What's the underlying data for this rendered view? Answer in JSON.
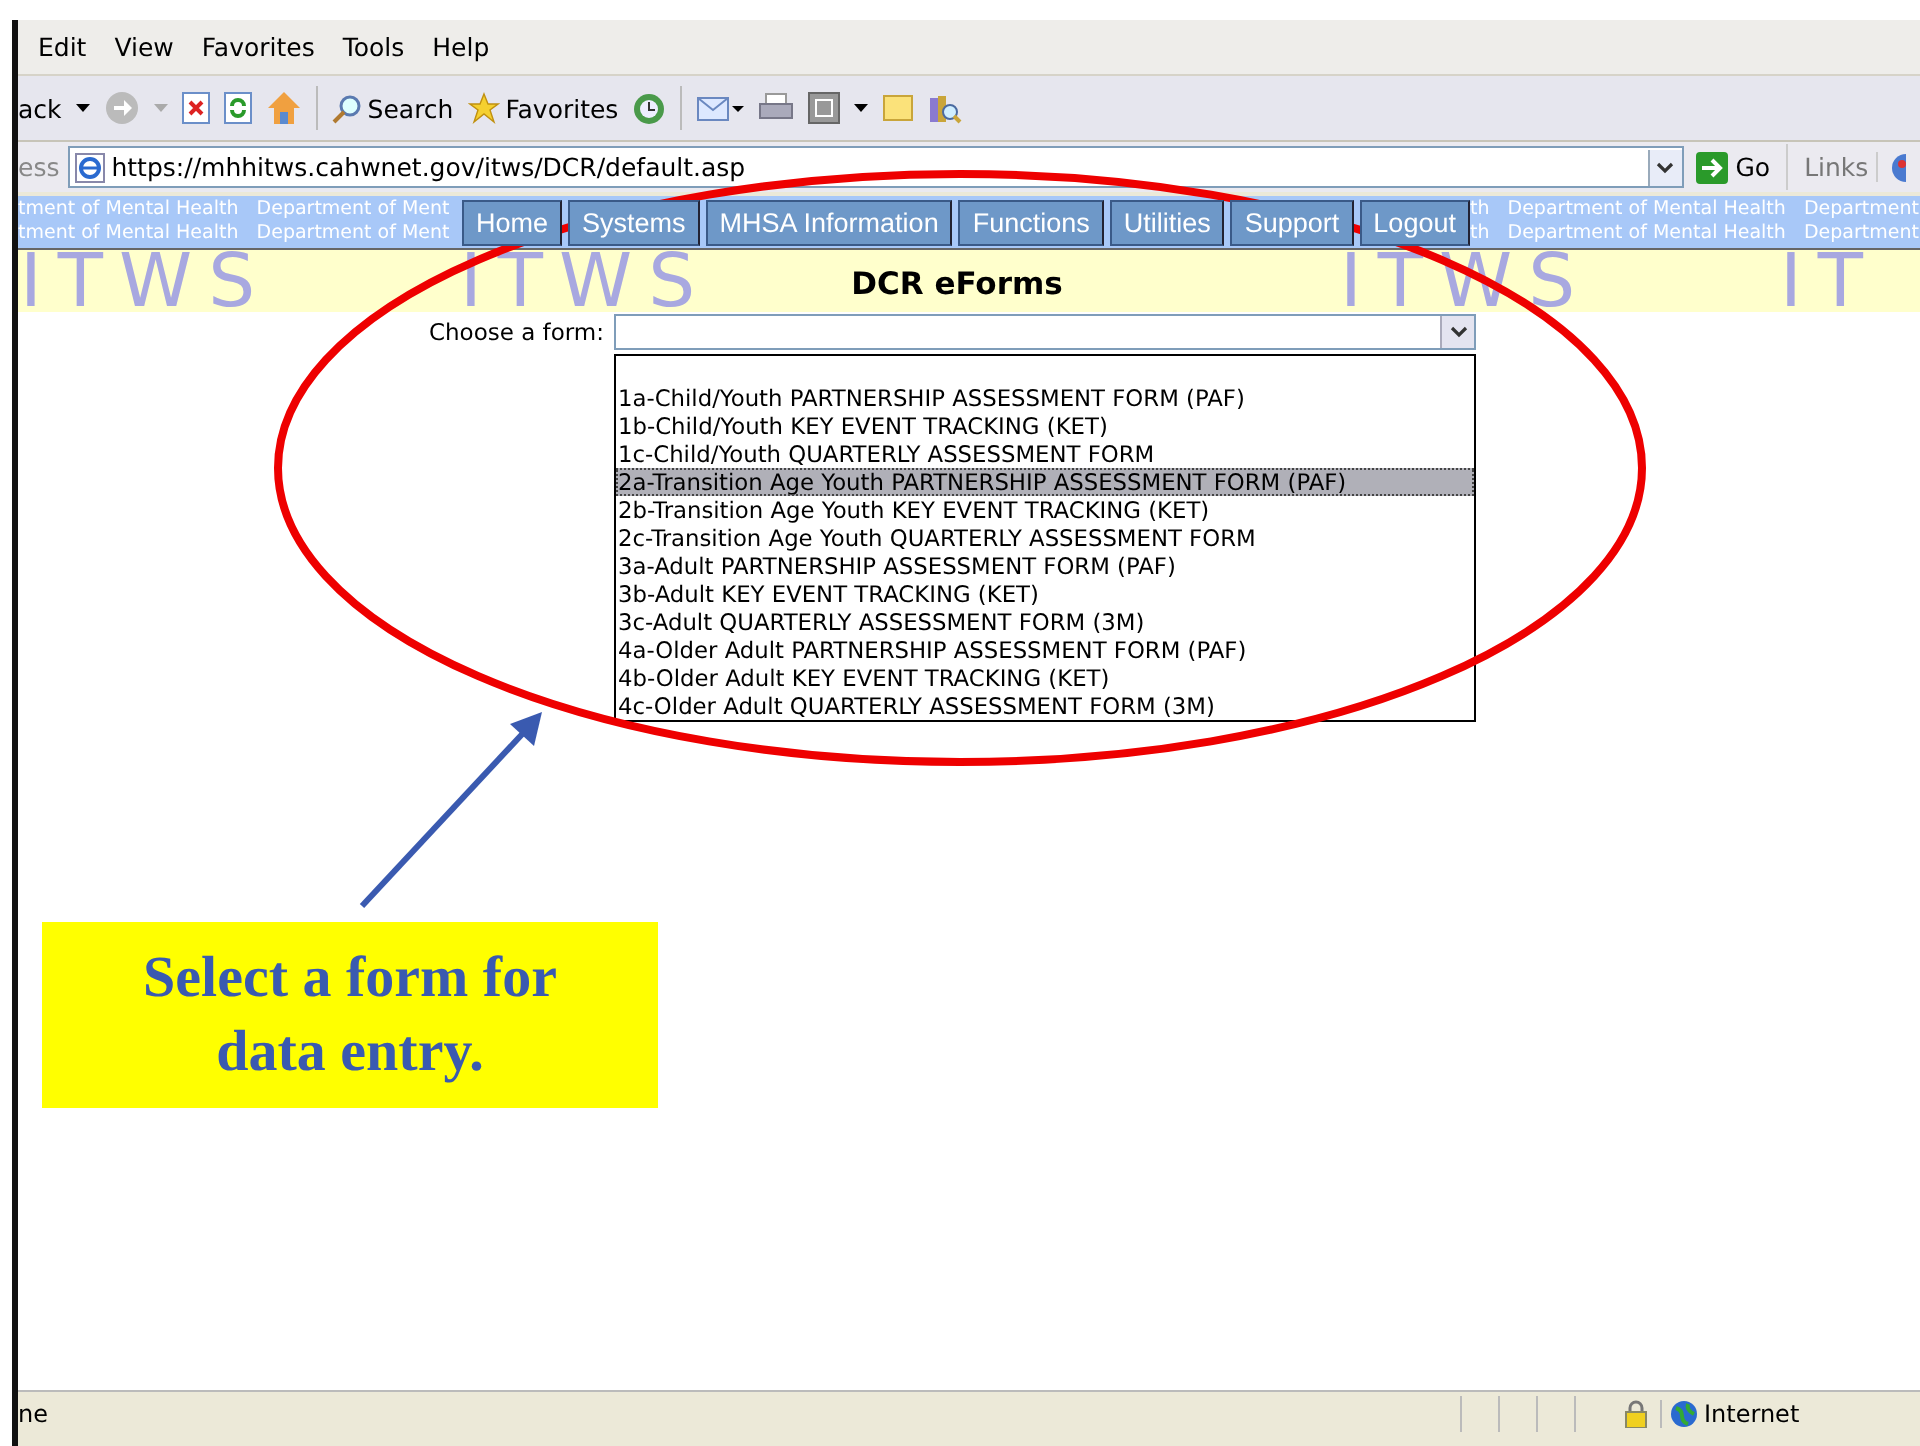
{
  "menu_bar": {
    "items": [
      "Edit",
      "View",
      "Favorites",
      "Tools",
      "Help"
    ]
  },
  "toolbar": {
    "back_label": "ack",
    "search_label": "Search",
    "favorites_label": "Favorites"
  },
  "address_bar": {
    "label": "ess",
    "url": "https://mhhitws.cahwnet.gov/itws/DCR/default.asp",
    "go_label": "Go",
    "links_label": "Links"
  },
  "banner": {
    "left_lines": [
      "tment of Mental Health   Department of Ment",
      "tment of Mental Health   Department of Ment"
    ],
    "right_lines": [
      "th   Department of Mental Health   Department",
      "th   Department of Mental Health   Department"
    ],
    "tabs": [
      {
        "label": "Home"
      },
      {
        "label": "Systems"
      },
      {
        "label": "MHSA Information"
      },
      {
        "label": "Functions"
      },
      {
        "label": "Utilities"
      },
      {
        "label": "Support"
      },
      {
        "label": "Logout"
      }
    ]
  },
  "watermark": [
    "ITWS",
    "ITWS",
    "ITWS",
    "IT"
  ],
  "page": {
    "title": "DCR eForms",
    "form_label": "Choose a form:",
    "options": [
      {
        "label": "1a-Child/Youth PARTNERSHIP ASSESSMENT FORM (PAF)",
        "selected": false
      },
      {
        "label": "1b-Child/Youth KEY EVENT TRACKING (KET)",
        "selected": false
      },
      {
        "label": "1c-Child/Youth QUARTERLY ASSESSMENT FORM",
        "selected": false
      },
      {
        "label": "2a-Transition Age Youth PARTNERSHIP ASSESSMENT FORM (PAF)",
        "selected": true
      },
      {
        "label": "2b-Transition Age Youth KEY EVENT TRACKING (KET)",
        "selected": false
      },
      {
        "label": "2c-Transition Age Youth QUARTERLY ASSESSMENT FORM",
        "selected": false
      },
      {
        "label": "3a-Adult PARTNERSHIP ASSESSMENT FORM (PAF)",
        "selected": false
      },
      {
        "label": "3b-Adult KEY EVENT TRACKING (KET)",
        "selected": false
      },
      {
        "label": "3c-Adult QUARTERLY ASSESSMENT FORM (3M)",
        "selected": false
      },
      {
        "label": "4a-Older Adult PARTNERSHIP ASSESSMENT FORM (PAF)",
        "selected": false
      },
      {
        "label": "4b-Older Adult KEY EVENT TRACKING (KET)",
        "selected": false
      },
      {
        "label": "4c-Older Adult QUARTERLY ASSESSMENT FORM (3M)",
        "selected": false
      }
    ]
  },
  "annotation": {
    "callout": "Select a form for data entry."
  },
  "status_bar": {
    "text": "ne",
    "zone": "Internet"
  }
}
